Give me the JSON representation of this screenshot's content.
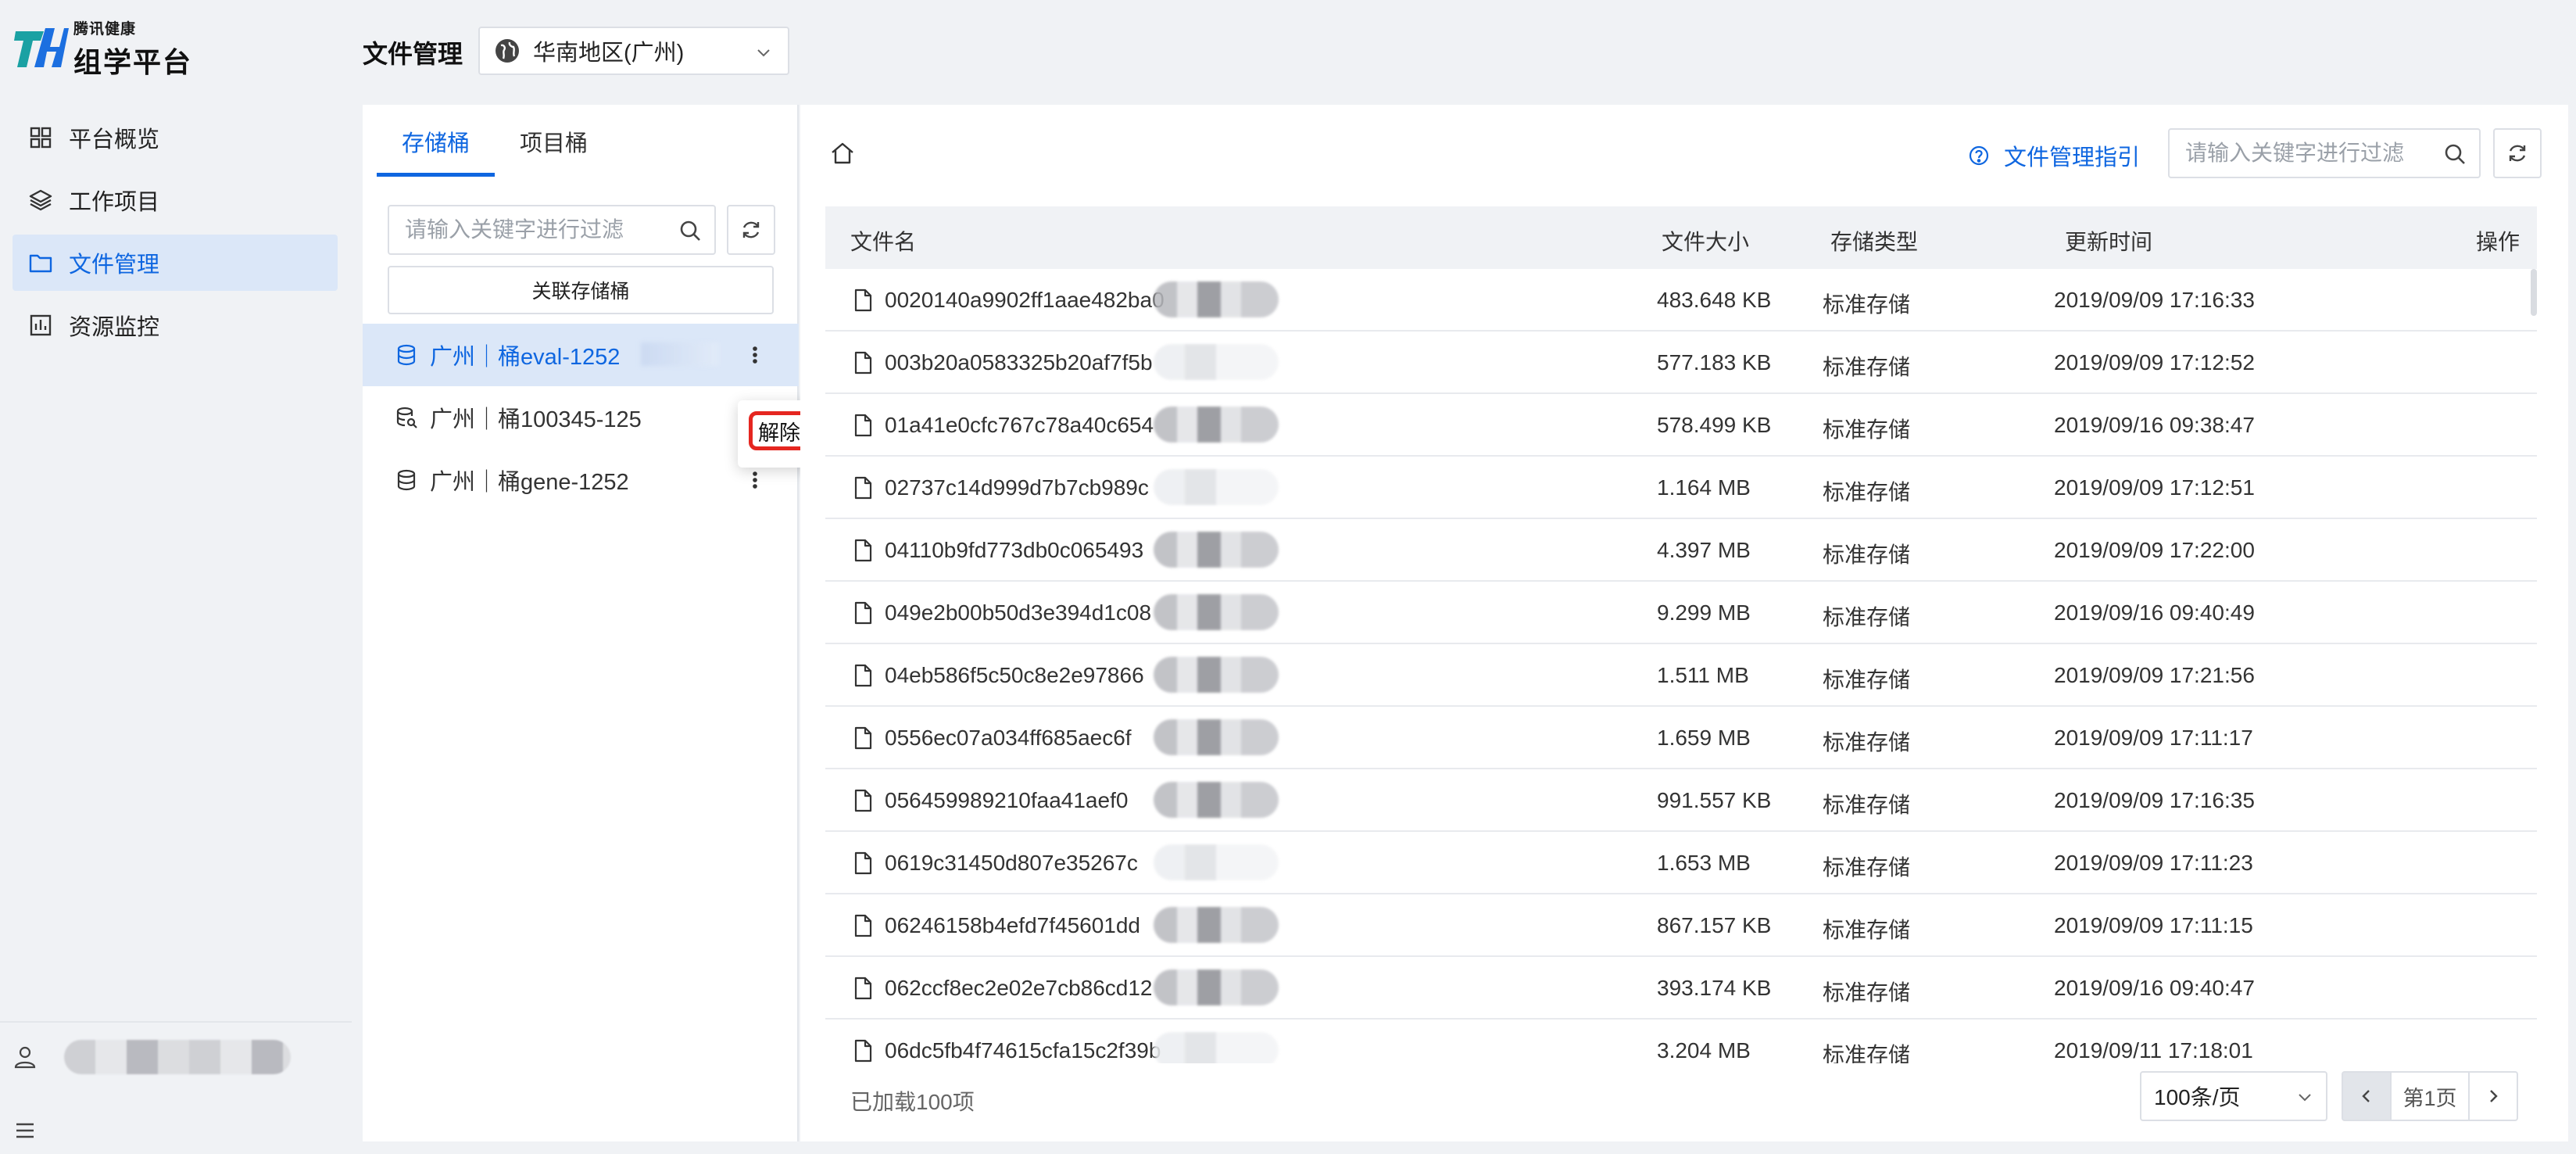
{
  "brand": {
    "small": "腾讯健康",
    "name": "组学平台",
    "accent": "#0e66e0"
  },
  "nav": {
    "items": [
      {
        "label": "平台概览",
        "icon": "grid-icon"
      },
      {
        "label": "工作项目",
        "icon": "layers-icon"
      },
      {
        "label": "文件管理",
        "icon": "folder-icon",
        "active": true
      },
      {
        "label": "资源监控",
        "icon": "bar-chart-icon"
      }
    ]
  },
  "header": {
    "title": "文件管理",
    "region": "华南地区(广州)"
  },
  "buckets": {
    "tabs": [
      "存储桶",
      "项目桶"
    ],
    "active_tab": 0,
    "search_placeholder": "请输入关键字进行过滤",
    "assoc_button": "关联存储桶",
    "items": [
      {
        "label": "广州｜桶eval-1252",
        "active": true
      },
      {
        "label": "广州｜桶100345-125"
      },
      {
        "label": "广州｜桶gene-1252"
      }
    ],
    "popover_action": "解除关联"
  },
  "files": {
    "guide_label": "文件管理指引",
    "search_placeholder": "请输入关键字进行过滤",
    "columns": [
      "文件名",
      "文件大小",
      "存储类型",
      "更新时间",
      "操作"
    ],
    "rows": [
      {
        "name": "0020140a9902ff1aae482ba0",
        "size": "483.648 KB",
        "type": "标准存储",
        "updated": "2019/09/09 17:16:33"
      },
      {
        "name": "003b20a0583325b20af7f5b",
        "size": "577.183 KB",
        "type": "标准存储",
        "updated": "2019/09/09 17:12:52"
      },
      {
        "name": "01a41e0cfc767c78a40c654",
        "size": "578.499 KB",
        "type": "标准存储",
        "updated": "2019/09/16 09:38:47"
      },
      {
        "name": "02737c14d999d7b7cb989c",
        "size": "1.164 MB",
        "type": "标准存储",
        "updated": "2019/09/09 17:12:51"
      },
      {
        "name": "04110b9fd773db0c065493",
        "size": "4.397 MB",
        "type": "标准存储",
        "updated": "2019/09/09 17:22:00"
      },
      {
        "name": "049e2b00b50d3e394d1c08",
        "size": "9.299 MB",
        "type": "标准存储",
        "updated": "2019/09/16 09:40:49"
      },
      {
        "name": "04eb586f5c50c8e2e97866",
        "size": "1.511 MB",
        "type": "标准存储",
        "updated": "2019/09/09 17:21:56"
      },
      {
        "name": "0556ec07a034ff685aec6f",
        "size": "1.659 MB",
        "type": "标准存储",
        "updated": "2019/09/09 17:11:17"
      },
      {
        "name": "056459989210faa41aef0",
        "size": "991.557 KB",
        "type": "标准存储",
        "updated": "2019/09/09 17:16:35"
      },
      {
        "name": "0619c31450d807e35267c",
        "size": "1.653 MB",
        "type": "标准存储",
        "updated": "2019/09/09 17:11:23"
      },
      {
        "name": "06246158b4efd7f45601dd",
        "size": "867.157 KB",
        "type": "标准存储",
        "updated": "2019/09/09 17:11:15"
      },
      {
        "name": "062ccf8ec2e02e7cb86cd12",
        "size": "393.174 KB",
        "type": "标准存储",
        "updated": "2019/09/16 09:40:47"
      },
      {
        "name": "06dc5fb4f74615cfa15c2f39b",
        "size": "3.204 MB",
        "type": "标准存储",
        "updated": "2019/09/11 17:18:01"
      }
    ],
    "loaded_text": "已加载100项",
    "page_size": "100条/页",
    "page_label": "第1页"
  }
}
